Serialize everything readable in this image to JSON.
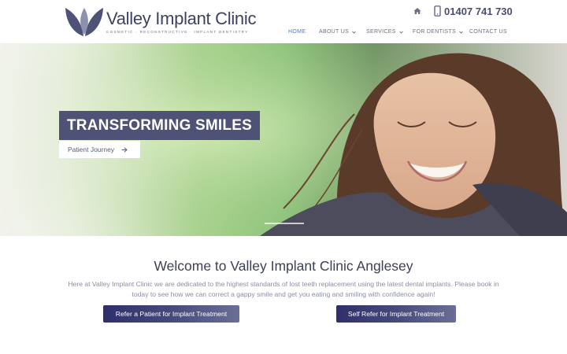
{
  "brand": {
    "name": "Valley Implant Clinic",
    "tagline": "COSMETIC · RECONSTRUCTIVE · IMPLANT DENTISTRY",
    "color": "#3d4163"
  },
  "header": {
    "home_icon": "home-icon",
    "phone_icon": "mobile-phone-icon",
    "phone": "01407 741 730"
  },
  "nav": {
    "items": [
      {
        "label": "HOME",
        "active": true,
        "dropdown": false
      },
      {
        "label": "ABOUT US",
        "active": false,
        "dropdown": true
      },
      {
        "label": "SERVICES",
        "active": false,
        "dropdown": true
      },
      {
        "label": "FOR DENTISTS",
        "active": false,
        "dropdown": true
      },
      {
        "label": "CONTACT US",
        "active": false,
        "dropdown": false
      }
    ],
    "active_color": "#3f7ec7"
  },
  "hero": {
    "title": "TRANSFORMING SMILES",
    "button_label": "Patient Journey",
    "button_icon": "arrow-right-icon",
    "title_bg": "#4d5276"
  },
  "welcome": {
    "title": "Welcome to Valley Implant Clinic Anglesey",
    "text": "Here at Valley Implant Clinic we are dedicated to the highest standards of lost teeth replacement using the latest dental implants. Please book in today to see how we can correct a gappy smile and get you eating and smiling with confidence again!"
  },
  "cta": {
    "refer": "Refer a Patient for Implant Treatment",
    "self_refer": "Self Refer for Implant Treatment"
  }
}
